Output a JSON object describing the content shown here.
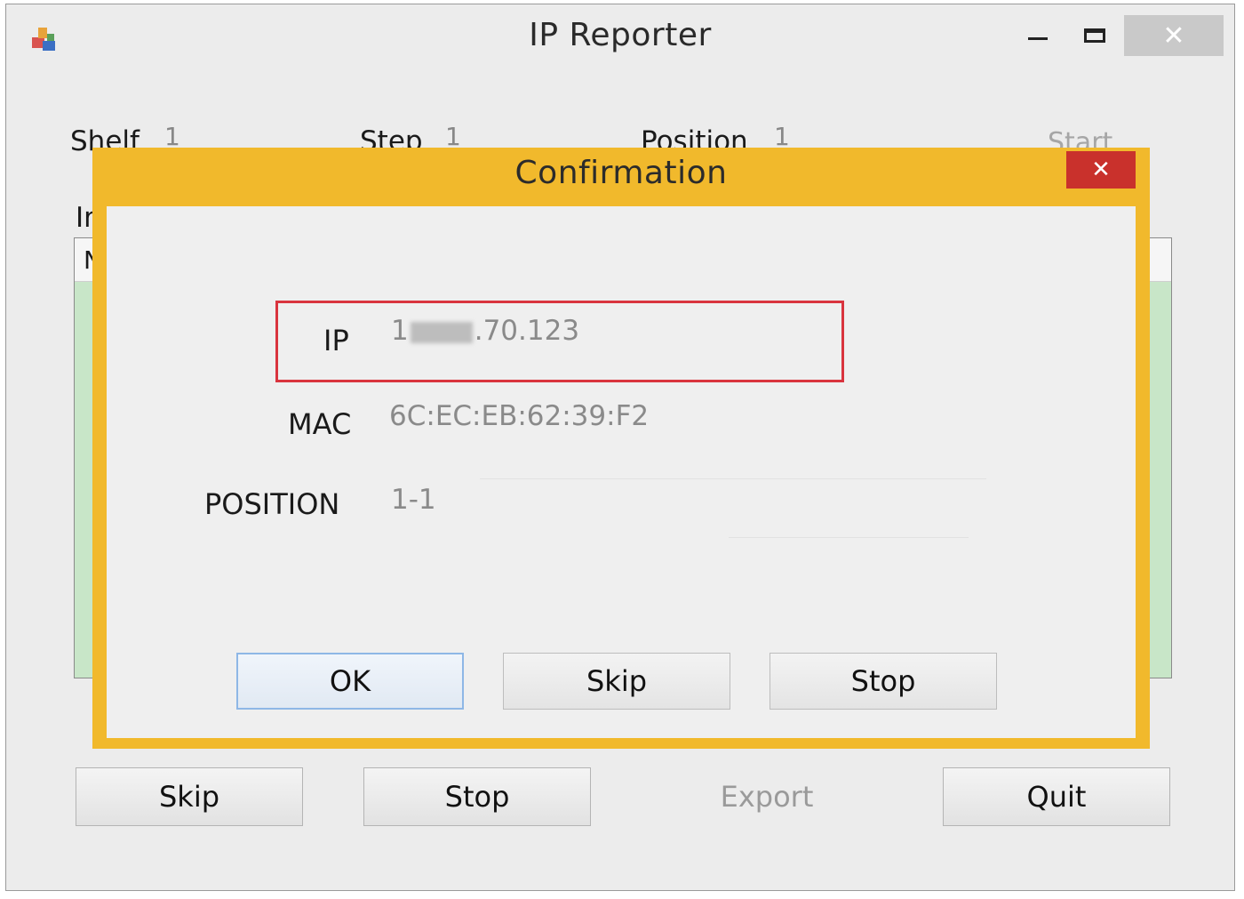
{
  "window": {
    "title": "IP Reporter",
    "controls": {
      "minimize": "–",
      "maximize": "☐",
      "close": "✕"
    }
  },
  "header": {
    "shelf_label": "Shelf",
    "shelf_value": "1",
    "step_label": "Step",
    "step_value": "1",
    "position_label": "Position",
    "position_value": "1",
    "start_label": "Start"
  },
  "info": {
    "label": "In",
    "list_header": "N"
  },
  "bottom_buttons": {
    "skip": "Skip",
    "stop": "Stop",
    "export": "Export",
    "quit": "Quit"
  },
  "dialog": {
    "title": "Confirmation",
    "close": "✕",
    "ip_label": "IP",
    "ip_value_prefix": "1",
    "ip_value_suffix": ".70.123",
    "mac_label": "MAC",
    "mac_value": "6C:EC:EB:62:39:F2",
    "position_label": "POSITION",
    "position_value": "1-1",
    "buttons": {
      "ok": "OK",
      "skip": "Skip",
      "stop": "Stop"
    }
  },
  "colors": {
    "dialog_border": "#f1b92c",
    "close_red": "#c9312c",
    "highlight_red": "#d9343e",
    "list_green": "#c8e6c8"
  }
}
